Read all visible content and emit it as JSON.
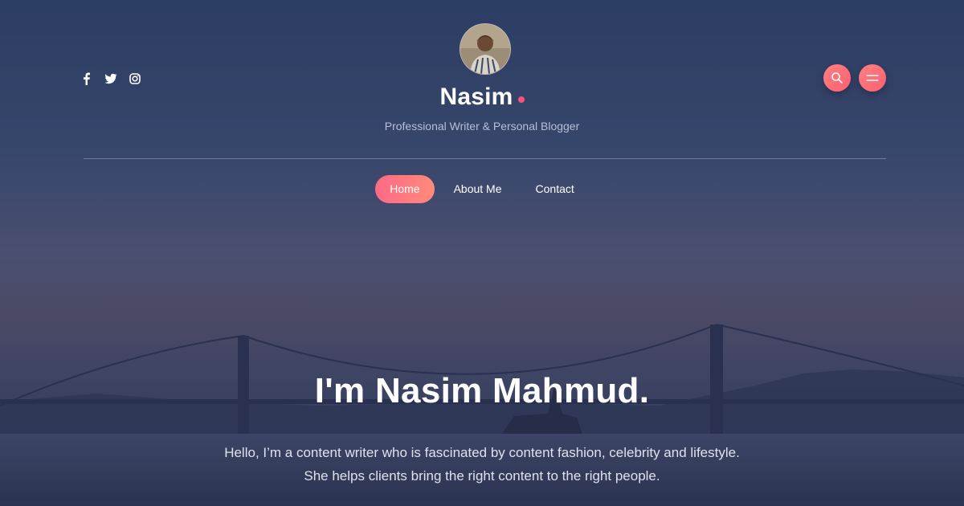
{
  "site": {
    "name": "Nasim",
    "tagline": "Professional Writer & Personal Blogger"
  },
  "social": [
    {
      "name": "facebook",
      "icon": "facebook-icon"
    },
    {
      "name": "twitter",
      "icon": "twitter-icon"
    },
    {
      "name": "instagram",
      "icon": "instagram-icon"
    }
  ],
  "actions": {
    "search_icon": "search-icon",
    "menu_icon": "menu-icon"
  },
  "nav": {
    "items": [
      {
        "label": "Home",
        "active": true
      },
      {
        "label": "About Me",
        "active": false
      },
      {
        "label": "Contact",
        "active": false
      }
    ]
  },
  "hero": {
    "title": "I'm Nasim Mahmud.",
    "line1": "Hello, I’m a content writer who is fascinated by content fashion, celebrity and lifestyle.",
    "line2": "She helps clients bring the right content to the right people."
  },
  "colors": {
    "accent": "#ff5f72",
    "accent_light": "#ff8a7a"
  }
}
